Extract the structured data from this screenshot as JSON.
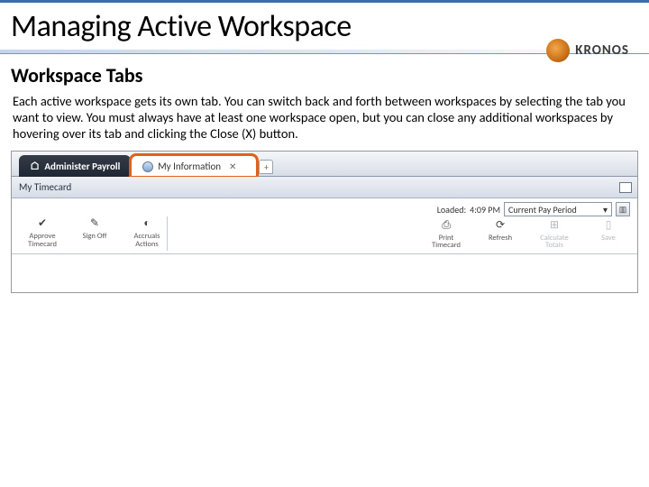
{
  "page_title": "Managing Active Workspace",
  "brand": "KRONOS",
  "section_title": "Workspace Tabs",
  "body_text": "Each active workspace gets its own tab. You can switch back and forth between workspaces by selecting the tab you want to view. You must always have at least one workspace open, but you can close any additional workspaces by hovering over its tab and clicking the Close (X) button.",
  "tabs": {
    "active": "Administer Payroll",
    "secondary": "My Information"
  },
  "panel": {
    "title": "My Timecard",
    "loaded_label": "Loaded:",
    "loaded_time": "4:09 PM",
    "period": "Current Pay Period"
  },
  "tools_left": [
    {
      "label": "Approve Timecard",
      "icon": "✔",
      "interactable": true
    },
    {
      "label": "Sign Off",
      "icon": "✎",
      "interactable": true
    },
    {
      "label": "Accruals Actions",
      "icon": "◐",
      "interactable": true
    }
  ],
  "tools_right": [
    {
      "label": "Print Timecard",
      "icon": "⎙",
      "interactable": true
    },
    {
      "label": "Refresh",
      "icon": "⟳",
      "interactable": true
    },
    {
      "label": "Calculate Totals",
      "icon": "⊞",
      "interactable": false
    },
    {
      "label": "Save",
      "icon": "▯",
      "interactable": false
    }
  ]
}
